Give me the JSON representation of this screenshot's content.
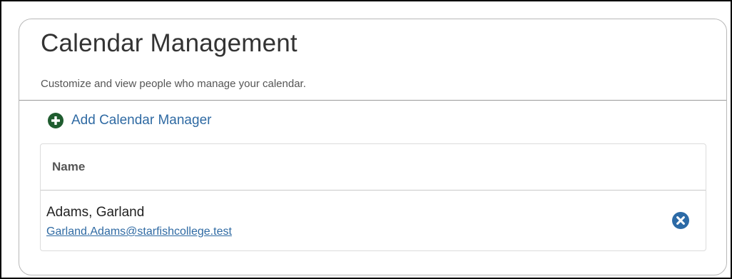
{
  "card": {
    "title": "Calendar Management",
    "subtitle": "Customize and view people who manage your calendar."
  },
  "actions": {
    "add_label": "Add Calendar Manager",
    "add_icon": "plus-circle-icon",
    "add_icon_color": "#1f5c2f"
  },
  "table": {
    "columns": [
      "Name"
    ],
    "rows": [
      {
        "name": "Adams, Garland",
        "email": "Garland.Adams@starfishcollege.test",
        "remove_icon": "x-circle-icon",
        "remove_icon_color": "#2c6aa6"
      }
    ]
  },
  "colors": {
    "link": "#2f6aa3",
    "text": "#333333",
    "border": "#b8b8b8"
  }
}
